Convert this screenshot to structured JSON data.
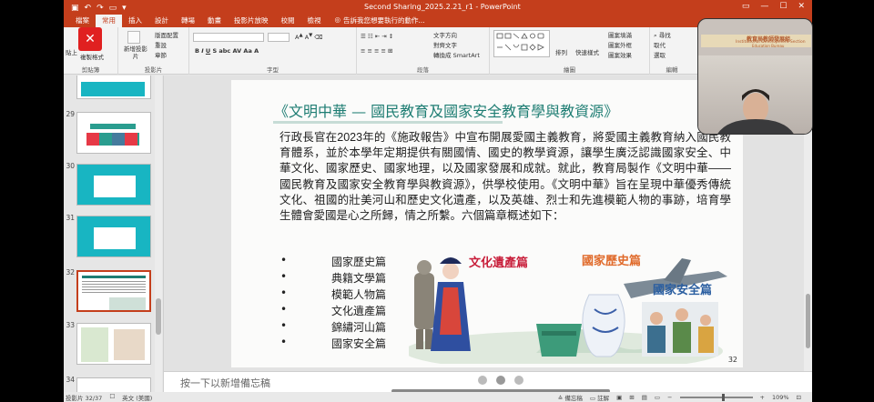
{
  "window": {
    "title": "Second Sharing_2025.2.21_r1 - PowerPoint"
  },
  "ribbon_tabs": [
    {
      "label": "檔案",
      "active": false
    },
    {
      "label": "常用",
      "active": true
    },
    {
      "label": "插入",
      "active": false
    },
    {
      "label": "設計",
      "active": false
    },
    {
      "label": "轉場",
      "active": false
    },
    {
      "label": "動畫",
      "active": false
    },
    {
      "label": "投影片放映",
      "active": false
    },
    {
      "label": "校閱",
      "active": false
    },
    {
      "label": "檢視",
      "active": false
    }
  ],
  "tell_me": "告訴我您想要執行的動作...",
  "ribbon": {
    "clipboard": {
      "label": "剪貼簿",
      "paste": "貼上",
      "format_painter": "複製格式"
    },
    "slides": {
      "label": "投影片",
      "new_slide": "新增投影片",
      "layout": "版面配置",
      "reset": "重設",
      "section": "章節"
    },
    "font": {
      "label": "字型"
    },
    "paragraph": {
      "label": "段落",
      "text_direction": "文字方向",
      "align_text": "對齊文字",
      "smartart": "轉換成 SmartArt"
    },
    "drawing": {
      "label": "繪圖",
      "arrange": "排列",
      "quick_styles": "快速樣式",
      "fill": "圖案填滿",
      "outline": "圖案外框",
      "effects": "圖案效果"
    },
    "editing": {
      "label": "編輯",
      "find": "尋找",
      "replace": "取代",
      "select": "選取"
    }
  },
  "thumbnails": [
    {
      "num": "29"
    },
    {
      "num": "30"
    },
    {
      "num": "31"
    },
    {
      "num": "32",
      "selected": true
    },
    {
      "num": "33"
    },
    {
      "num": "34"
    }
  ],
  "slide": {
    "title": "《文明中華 — 國民教育及國家安全教育學與教資源》",
    "body": "行政長官在2023年的《施政報告》中宣布開展愛國主義教育，將愛國主義教育納入國民教育體系，並於本學年定期提供有關國情、國史的教學資源，讓學生廣泛認識國家安全、中華文化、國家歷史、國家地理，以及國家發展和成就。就此，教育局製作《文明中華——國民教育及國家安全教育學與教資源》，供學校使用。《文明中華》旨在呈現中華優秀傳統文化、祖國的壯美河山和歷史文化遺產，以及英雄、烈士和先進模範人物的事跡，培育學生體會愛國是心之所歸，情之所繫。六個篇章概述如下：",
    "bullets": [
      "國家歷史篇",
      "典籍文學篇",
      "模範人物篇",
      "文化遺產篇",
      "錦繡河山篇",
      "國家安全篇"
    ],
    "bullet_symbol": "•",
    "image_labels": {
      "heritage": "文化遺產篇",
      "history": "國家歷史篇",
      "security": "國家安全篇"
    },
    "number": "32"
  },
  "notes": {
    "placeholder": "按一下以新增備忘稿"
  },
  "status": {
    "slide_counter": "投影片 32/37",
    "language": "英文 (美國)",
    "notes_btn": "備忘稿",
    "comments_btn": "註解",
    "zoom": "109%"
  },
  "webcam": {
    "banner_line1": "教育局教師發展組",
    "banner_line2": "Institutional Development Section",
    "banner_line3": "Education Bureau"
  },
  "colors": {
    "accent": "#c43e1c",
    "title_teal": "#1e7d73",
    "heritage_red": "#c81e3a",
    "history_orange": "#e06a2a",
    "security_blue": "#2a5ea0"
  }
}
